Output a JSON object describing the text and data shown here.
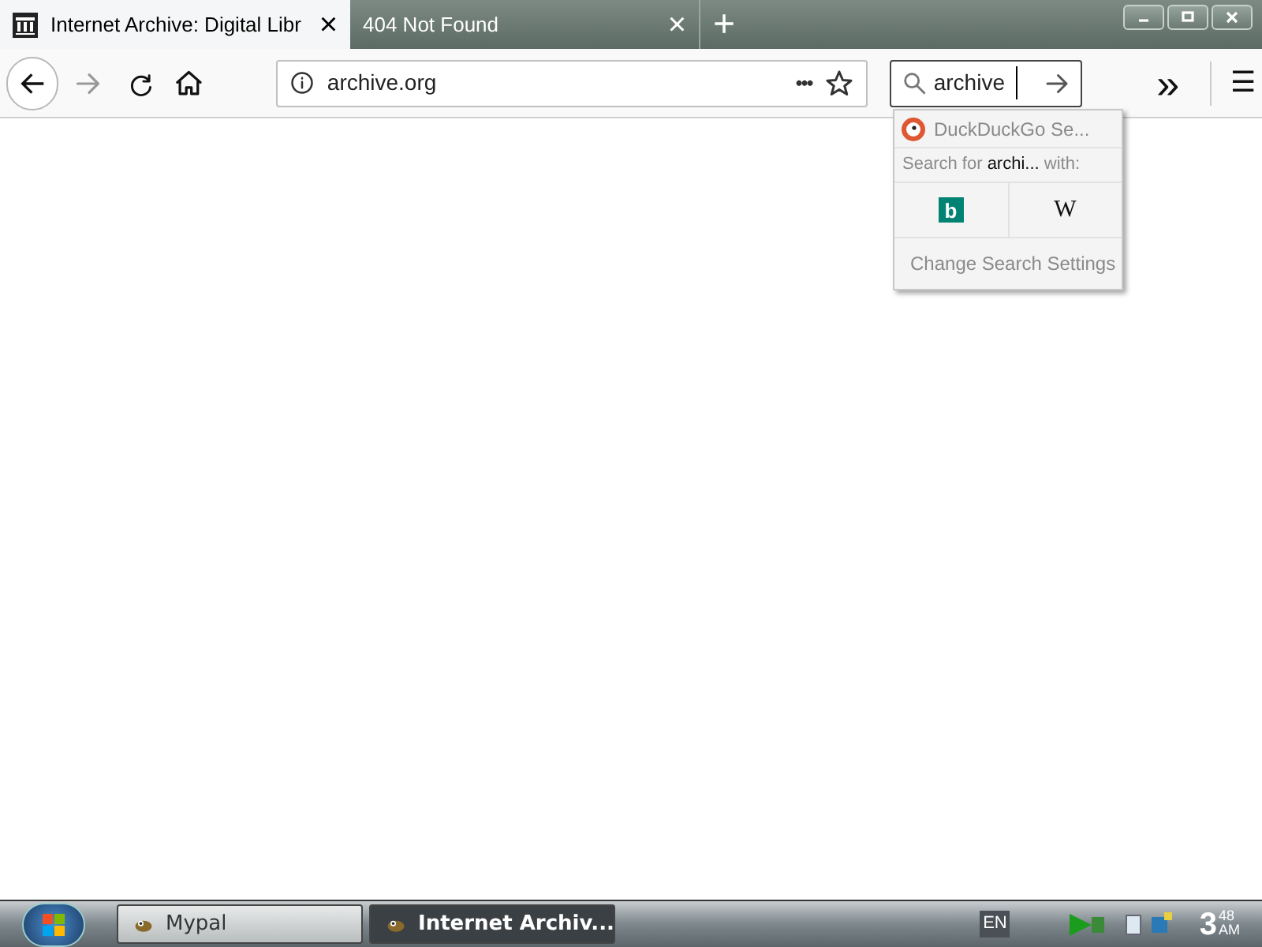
{
  "tabs": [
    {
      "title": "Internet Archive: Digital Libr",
      "selected": true,
      "close": "×"
    },
    {
      "title": "404 Not Found",
      "selected": false,
      "close": "×"
    }
  ],
  "new_tab": "+",
  "toolbar": {
    "url": "archive.org",
    "page_actions": "•••",
    "search_value": "archive",
    "overflow": "»",
    "menu": "☰"
  },
  "search_popup": {
    "header": "DuckDuckGo Se...",
    "prompt_before": "Search for ",
    "prompt_term": "archi...",
    "prompt_after": " with:",
    "engines": [
      {
        "kind": "bing",
        "label": "b"
      },
      {
        "kind": "wikipedia",
        "label": "W"
      }
    ],
    "settings": "Change Search Settings"
  },
  "taskbar": {
    "buttons": [
      {
        "label": "Mypal",
        "selected": false
      },
      {
        "label": "Internet Archiv...",
        "selected": true
      }
    ],
    "language": "EN",
    "clock": {
      "hour": "3",
      "minute": "48",
      "period": "AM"
    }
  }
}
